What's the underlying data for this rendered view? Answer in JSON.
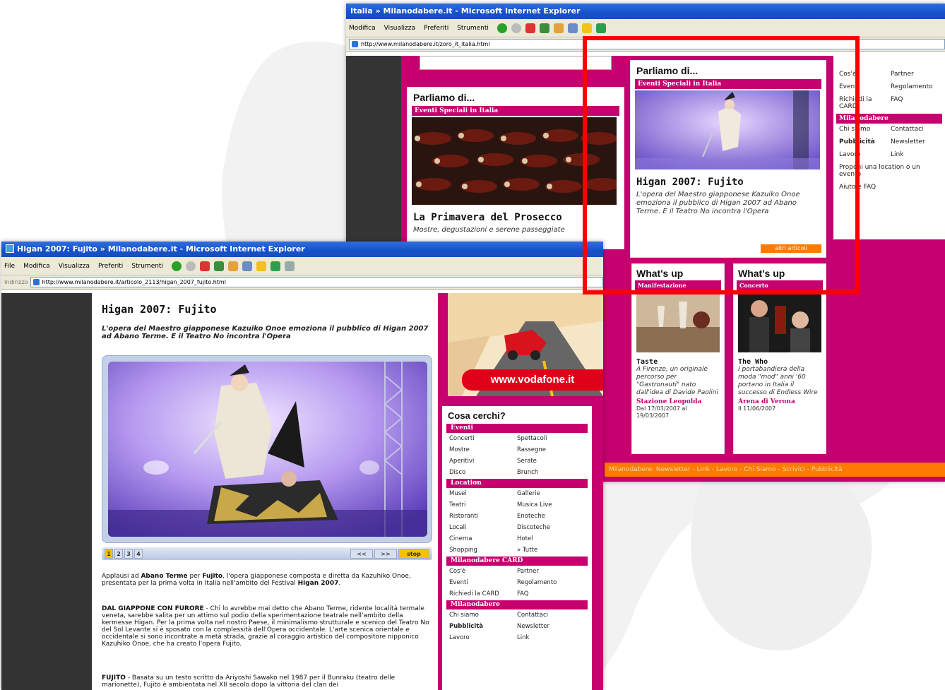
{
  "back_window": {
    "title": "Italia » Milanodabere.it - Microsoft Internet Explorer",
    "menu": [
      "Modifica",
      "Visualizza",
      "Preferiti",
      "Strumenti"
    ],
    "url": "http://www.milanodabere.it/zoro_it_italia.html",
    "left_box": {
      "heading": "Parliamo di...",
      "category": "Eventi Speciali in Italia",
      "title": "La Primavera del Prosecco",
      "desc": "Mostre, degustazioni e serene passeggiate"
    },
    "center_box": {
      "heading": "Parliamo di...",
      "category": "Eventi Speciali in Italia",
      "title": "Higan 2007: Fujito",
      "desc": "L'opera del Maestro giapponese Kazuiko Onoe emoziona il pubblico di Higan 2007 ad Abano Terme. E il Teatro No incontra l'Opera",
      "more": "altri articoli"
    },
    "whatsup": [
      {
        "heading": "What's up",
        "category": "Manifestazione",
        "title": "Taste",
        "desc": "A Firenze, un originale percorso per \"Gastronauti\" nato dall'idea di Davide Paolini",
        "venue": "Stazione Leopolda",
        "date": "Dal 17/03/2007 al 19/03/2007"
      },
      {
        "heading": "What's up",
        "category": "Concerto",
        "title": "The Who",
        "desc": "I portabandiera della moda \"mod\" anni '60 portano in Italia il successo di Endless Wire",
        "venue": "Arena di Verona",
        "date": "Il 11/06/2007"
      }
    ],
    "right_card": [
      "Cos'è",
      "Partner",
      "Eventi",
      "Regolamento",
      "Richiedi la CARD",
      "FAQ"
    ],
    "right_section": "Milanodabere",
    "right_links": [
      "Chi siamo",
      "Contattaci",
      "Pubblicità",
      "Newsletter",
      "Lavoro",
      "Link",
      "Proponi una location o un evento",
      "",
      "Aiuto e FAQ",
      ""
    ],
    "footer": "Milanodabere: Newsletter - Link - Lavoro - Chi Siamo - Scrivici - Pubblicità"
  },
  "front_window": {
    "title": "Higan 2007: Fujito » Milanodabere.it - Microsoft Internet Explorer",
    "menu": [
      "File",
      "Modifica",
      "Visualizza",
      "Preferiti",
      "Strumenti"
    ],
    "address_label": "Indirizzo",
    "url": "http://www.milanodabere.it/articolo_2113/higan_2007_fujito.html",
    "article": {
      "title": "Higan 2007: Fujito",
      "subtitle": "L'opera del Maestro giapponese Kazuiko Onoe emoziona il pubblico di Higan 2007 ad Abano Terme. E il Teatro No incontra l'Opera",
      "p1_a": "Applausi ad ",
      "p1_b": "Abano Terme",
      "p1_c": " per ",
      "p1_d": "Fujito",
      "p1_e": ", l'opera giapponese composta e diretta da Kazuhiko Onoe, presentata per la prima volta in Italia nell'ambito del Festival ",
      "p1_f": "Higan 2007",
      "p1_g": ".",
      "p2_head": "DAL GIAPPONE CON FURORE",
      "p2_body": " - Chi lo avrebbe mai detto che Abano Terme, ridente località termale veneta, sarebbe salita per un attimo sul podio della sperimentazione teatrale nell'ambito della kermesse Higan. Per la prima volta nel nostro Paese, il minimalismo strutturale e scenico del Teatro No del Sol Levante si è sposato con la complessità dell'Opera occidentale. L'arte scenica orientale e occidentale si sono incontrate a metà strada, grazie al coraggio artistico del compositore nipponico Kazuhiko Onoe, che ha creato l'opera Fujito.",
      "p3_head": "FUJITO",
      "p3_body": " - Basata su un testo scritto da Ariyoshi Sawako nel 1987 per il Bunraku (teatro delle marionette), Fujito è ambientata nel XII secolo dopo la vittoria del clan dei"
    },
    "gallery": {
      "pages": [
        "1",
        "2",
        "3",
        "4"
      ],
      "prev": "<<",
      "next": ">>",
      "stop": "stop"
    },
    "ad": {
      "url": "www.vodafone.it"
    },
    "search": {
      "heading": "Cosa cerchi?",
      "sections": [
        {
          "title": "Eventi",
          "items": [
            "Concerti",
            "Spettacoli",
            "Mostre",
            "Rassegne",
            "Aperitivi",
            "Serate",
            "Disco",
            "Brunch"
          ]
        },
        {
          "title": "Location",
          "items": [
            "Musei",
            "Gallerie",
            "Teatri",
            "Musica Live",
            "Ristoranti",
            "Enoteche",
            "Locali",
            "Discoteche",
            "Cinema",
            "Hotel",
            "Shopping",
            "» Tutte"
          ]
        },
        {
          "title": "Milanodabere CARD",
          "items": [
            "Cos'è",
            "Partner",
            "Eventi",
            "Regolamento",
            "Richiedi la CARD",
            "FAQ"
          ]
        },
        {
          "title": "Milanodabere",
          "items": [
            "Chi siamo",
            "Contattaci",
            "Pubblicità",
            "Newsletter",
            "Lavoro",
            "Link"
          ]
        }
      ]
    }
  },
  "colors": {
    "magenta": "#c6006e",
    "orange": "#ff7a00",
    "highlight": "#ff0000",
    "xp_blue": "#1550c8"
  }
}
